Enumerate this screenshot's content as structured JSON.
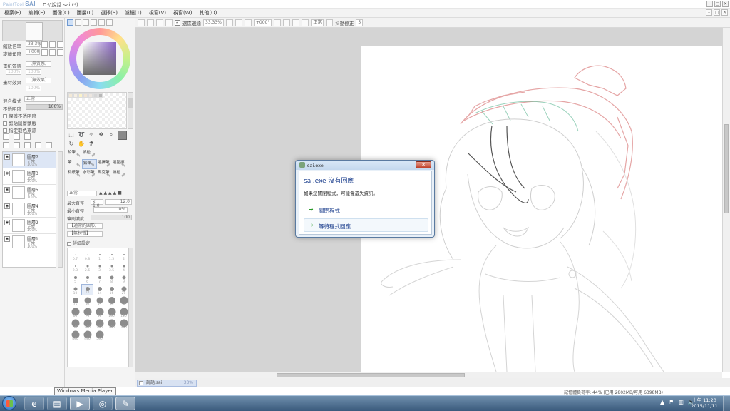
{
  "app": {
    "logo_prefix": "PaintTool",
    "logo": "SAI",
    "document_title": "D:\\\\說話.sai (*)"
  },
  "menu": [
    "檔案(F)",
    "編輯(E)",
    "圖像(C)",
    "圖層(L)",
    "選擇(S)",
    "濾鏡(T)",
    "視窗(V)",
    "視窗(W)",
    "其他(O)"
  ],
  "toolbar": {
    "selection_label": "選區邊緣",
    "zoom": "33.33%",
    "angle": "+000°",
    "blend": "正常",
    "stabilizer_label": "抖動修正",
    "stabilizer_value": "5"
  },
  "left_panel": {
    "zoom_label": "縮放倍率",
    "zoom_value": "33.3%",
    "angle_label": "旋轉角度",
    "angle_value": "+000",
    "paper_label": "畫紙質感",
    "paper_value": "【無質感】",
    "paper_sub1": "100%",
    "paper_sub2": "100%",
    "effect_label": "畫材效果",
    "effect_value": "【無效果】",
    "effect_sub": "100%",
    "blend_label": "混合模式",
    "blend_value": "正常",
    "opacity_label": "不透明度",
    "opacity_value": "100%",
    "checks": [
      "保護不透明度",
      "剪貼圖層蒙版",
      "指定取色來源"
    ]
  },
  "layers": [
    {
      "name": "圖層7",
      "mode": "正常",
      "opacity": "100%"
    },
    {
      "name": "圖層3",
      "mode": "正常",
      "opacity": "100%"
    },
    {
      "name": "圖層5",
      "mode": "正常",
      "opacity": "100%"
    },
    {
      "name": "圖層4",
      "mode": "正常",
      "opacity": "100%"
    },
    {
      "name": "圖層2",
      "mode": "正常",
      "opacity": "100%"
    },
    {
      "name": "圖層1",
      "mode": "正常",
      "opacity": "100%"
    }
  ],
  "brushes": [
    {
      "name": "鉛筆",
      "icon": "✎"
    },
    {
      "name": "噴槍",
      "icon": "✐"
    },
    {
      "name": "筆",
      "icon": "✎"
    },
    {
      "name": "鉛筆",
      "icon": "✎"
    },
    {
      "name": "選擇筆",
      "icon": "✐"
    },
    {
      "name": "選區擦",
      "icon": "✎"
    },
    {
      "name": "和紙筆",
      "icon": "✎"
    },
    {
      "name": "水彩筆",
      "icon": "✐"
    },
    {
      "name": "馬克筆",
      "icon": "✎"
    },
    {
      "name": "噴槍",
      "icon": "✐"
    }
  ],
  "brush_params": {
    "mode": "正常",
    "max_size_label": "最大直徑",
    "max_size_mult": "x 1.0",
    "max_size_value": "12.0",
    "min_size_label": "最小直徑",
    "min_size_value": "0%",
    "density_label": "筆刷濃度",
    "density_value": "100",
    "shape_value": "【通常的圓形】",
    "texture_value": "【無材質】",
    "detail_label": "詳細設定"
  },
  "brush_sizes": [
    "0.7",
    "0.8",
    "1",
    "1.5",
    "2",
    "2.3",
    "2.6",
    "3",
    "3.5",
    "4",
    "5",
    "6",
    "7",
    "8",
    "9",
    "10",
    "12",
    "14",
    "16",
    "20",
    "25",
    "30",
    "35",
    "40",
    "50",
    "60",
    "70",
    "80",
    "100",
    "120",
    "160",
    "200",
    "250",
    "300",
    "350",
    "400",
    "450",
    "500"
  ],
  "document_tab": {
    "name": "說話.sai",
    "zoom": "33%"
  },
  "status": "記憶體負荷率: 44% (已用 2802MB/可用 6398MB)",
  "dialog": {
    "title": "sai.exe",
    "heading": "sai.exe 沒有回應",
    "message": "如果您關閉程式，可能會遺失資訊。",
    "option_close": "關閉程式",
    "option_wait": "等待程式回應"
  },
  "tooltip": "Windows Media Player",
  "taskbar": {
    "apps": [
      "ie-icon",
      "explorer-icon",
      "media-player-icon",
      "chrome-icon",
      "sai-icon"
    ],
    "time": "上午 11:20",
    "date": "2015/11/11"
  }
}
